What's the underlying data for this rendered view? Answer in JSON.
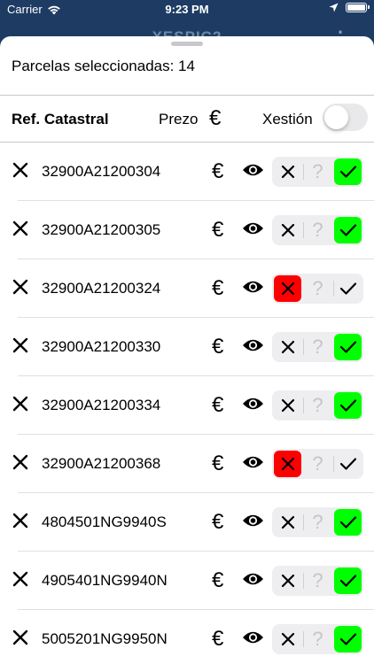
{
  "status_bar": {
    "carrier": "Carrier",
    "time": "9:23 PM"
  },
  "background": {
    "title": "XESPIC2"
  },
  "sheet": {
    "selected_label": "Parcelas seleccionadas: 14",
    "header": {
      "ref_label": "Ref. Catastral",
      "price_label": "Prezo",
      "manage_label": "Xestión",
      "toggle_on": false
    }
  },
  "colors": {
    "reject": "#ff0000",
    "accept": "#00ff00",
    "nav_bg": "#1e3c63"
  },
  "parcels": [
    {
      "ref": "32900A21200304",
      "status": "accepted"
    },
    {
      "ref": "32900A21200305",
      "status": "accepted"
    },
    {
      "ref": "32900A21200324",
      "status": "rejected"
    },
    {
      "ref": "32900A21200330",
      "status": "accepted"
    },
    {
      "ref": "32900A21200334",
      "status": "accepted"
    },
    {
      "ref": "32900A21200368",
      "status": "rejected"
    },
    {
      "ref": "4804501NG9940S",
      "status": "accepted"
    },
    {
      "ref": "4905401NG9940N",
      "status": "accepted"
    },
    {
      "ref": "5005201NG9950N",
      "status": "accepted"
    }
  ]
}
